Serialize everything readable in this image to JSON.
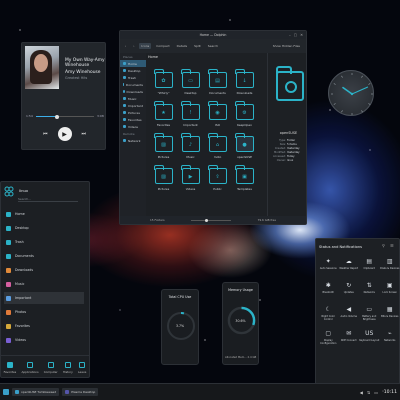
{
  "music": {
    "title": "My Own Way-Amy Winehouse",
    "artist": "Amy Winehouse",
    "album": "Greatest Hits",
    "time_elapsed": "1:54",
    "time_total": "3:08",
    "progress": 0.37
  },
  "file_manager": {
    "window_title": "Home — Dolphin",
    "toolbar": [
      "Icons",
      "Compact",
      "Details",
      "Split",
      "Search"
    ],
    "toolbar_right": "Show Hidden Files",
    "breadcrumb": "Home",
    "places_header": "Places",
    "places": [
      "Home",
      "Desktop",
      "Trash",
      "Documents",
      "Downloads",
      "Music",
      "Important",
      "Pictures",
      "Favorites",
      "Videos"
    ],
    "remote_header": "Remote",
    "remote": [
      "Network"
    ],
    "items": [
      "\"Whirly\"",
      "Desktop",
      "Documents",
      "Downloads",
      "Favorites",
      "Important",
      "ISO",
      "KeepOpen",
      "Pictures",
      "Music",
      "moto",
      "openSUSE",
      "Pictures",
      "Videos",
      "Public",
      "Templates"
    ],
    "selected_item": "openSUSE",
    "info": {
      "name": "openSUSE",
      "props": [
        [
          "Type:",
          "Folder"
        ],
        [
          "Size:",
          "5 items"
        ],
        [
          "Created:",
          "Yesterday"
        ],
        [
          "Modified:",
          "Yesterday"
        ],
        [
          "Accessed:",
          "Today"
        ],
        [
          "Owner:",
          "linux"
        ]
      ]
    },
    "status_left": "15 Folders",
    "status_right": "79.6 GiB free"
  },
  "clock": {
    "hour": 10,
    "minute": 11
  },
  "launcher": {
    "user": "linux",
    "search_placeholder": "Search...",
    "categories": [
      "Home",
      "Desktop",
      "Trash",
      "Documents",
      "Downloads",
      "Music",
      "Important",
      "Photos",
      "Favorites",
      "Videos"
    ],
    "active_category": "Important",
    "tabs": [
      "Favorites",
      "Applications",
      "Computer",
      "History",
      "Leave"
    ]
  },
  "cpu": {
    "title": "Total CPU Use",
    "value": "3.7%",
    "percent": 3.7
  },
  "memory": {
    "title": "Memory Usage",
    "value": "30.6%",
    "percent": 30.6,
    "sub": "Allocated Mem...  2.4 GB"
  },
  "status_notifications": {
    "title": "Status and Notifications",
    "tiles": [
      {
        "icon": "notifications-icon",
        "glyph": "✦",
        "label": "Auto Sessions"
      },
      {
        "icon": "weather-icon",
        "glyph": "☁",
        "label": "Weather Report"
      },
      {
        "icon": "clipboard-icon",
        "glyph": "▤",
        "label": "Clipboard"
      },
      {
        "icon": "disks-icon",
        "glyph": "▥",
        "label": "Disks & Devices"
      },
      {
        "icon": "bluetooth-icon",
        "glyph": "✱",
        "label": "Bluetooth"
      },
      {
        "icon": "updates-icon",
        "glyph": "↻",
        "label": "Updates"
      },
      {
        "icon": "network-icon",
        "glyph": "⇅",
        "label": "Networks"
      },
      {
        "icon": "lock-icon",
        "glyph": "▣",
        "label": "Lock Screen"
      },
      {
        "icon": "night-color-icon",
        "glyph": "☾",
        "label": "Night Color Control"
      },
      {
        "icon": "volume-icon",
        "glyph": "◀",
        "label": "Audio Volume"
      },
      {
        "icon": "battery-icon",
        "glyph": "▭",
        "label": "Battery and Brightness"
      },
      {
        "icon": "display-icon",
        "glyph": "▦",
        "label": "Bits & Devices"
      },
      {
        "icon": "display-config-icon",
        "glyph": "▢",
        "label": "Display Configuration"
      },
      {
        "icon": "kde-connect-icon",
        "glyph": "✉",
        "label": "KDE Connect"
      },
      {
        "icon": "keyboard-icon",
        "glyph": "US",
        "label": "Keyboard Layout"
      },
      {
        "icon": "networks-icon",
        "glyph": "⌁",
        "label": "Networks"
      }
    ]
  },
  "taskbar": {
    "tasks": [
      "openSUSE Tumbleweed",
      "Plasma Desktop"
    ],
    "time": "10:11"
  }
}
